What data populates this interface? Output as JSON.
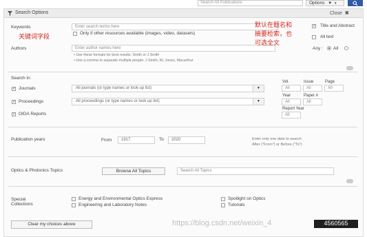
{
  "topbar": {
    "search_placeholder": "Search All Publications",
    "options_label": "Options",
    "go_icon": "search-icon"
  },
  "header": {
    "title": "Search Options",
    "close_label": "Close"
  },
  "keywords": {
    "label": "Keywords",
    "placeholder": "Enter search terms here",
    "other_resources_label": "Only if other resources available (images, video, datasets)",
    "scope_title_abstract": "Title and Abstract",
    "scope_all_text": "All text",
    "title_abstract_checked": true,
    "all_text_checked": false
  },
  "authors": {
    "label": "Authors",
    "placeholder": "Enter author names here",
    "hint1": "• Use these formats for best results: Smith or J Smith",
    "hint2": "• Use a comma to separate multiple people: J Smith, RL Jones, Macarthur",
    "any_label": "Any :",
    "all_label": "All",
    "any_checked": false,
    "all_checked": true
  },
  "search_in": {
    "label": "Search in:",
    "journals": {
      "label": "Journals",
      "checked": true,
      "select": "All journals (or type names or look up list)"
    },
    "proceedings": {
      "label": "Proceedings",
      "checked": true,
      "select": "All proceedings (or type names or look up list)"
    },
    "oida": {
      "label": "OIDA Reports",
      "checked": true
    },
    "vol_label": "Vol.",
    "issue_label": "Issue",
    "page_label": "Page",
    "year_label": "Year",
    "paper_label": "Paper #",
    "report_year_label": "Report Year",
    "vol_value": "All",
    "issue_value": "All",
    "page_value": "All",
    "year_value": "All",
    "paper_value": "All",
    "report_year_value": "All"
  },
  "pub_years": {
    "label": "Publication years",
    "from_label": "From",
    "from_value": "1917",
    "to_label": "To",
    "to_value": "2020",
    "hint1": "Enter only one date to search",
    "hint2": "After (\"From\") or Before (\"To\")"
  },
  "topics": {
    "label": "Optics & Photonics Topics",
    "browse_label": "Browse All Topics",
    "search_placeholder": "Search All Topics"
  },
  "special": {
    "label_line1": "Special",
    "label_line2": "Collections",
    "items": [
      {
        "label": "Energy and Environmental Optics Express",
        "checked": false
      },
      {
        "label": "Spotlight on Optics",
        "checked": false
      },
      {
        "label": "Engineering and Laboratory Notes",
        "checked": false
      },
      {
        "label": "Tutorials",
        "checked": false
      }
    ]
  },
  "footer": {
    "clear_label": "Clear my choices above"
  },
  "annotations": {
    "keyword_field": "关键词字段",
    "default_scope_line1": "默认在题名和",
    "default_scope_line2": "摘要检索，也",
    "default_scope_line3": "可选全文"
  },
  "watermark": {
    "text": "https://blog.csdn.net/weixin_4",
    "badge": "4560565"
  },
  "colors": {
    "accent": "#2e5aa8",
    "annotation": "#d4281f",
    "panel_bg": "#fbfbfb"
  }
}
